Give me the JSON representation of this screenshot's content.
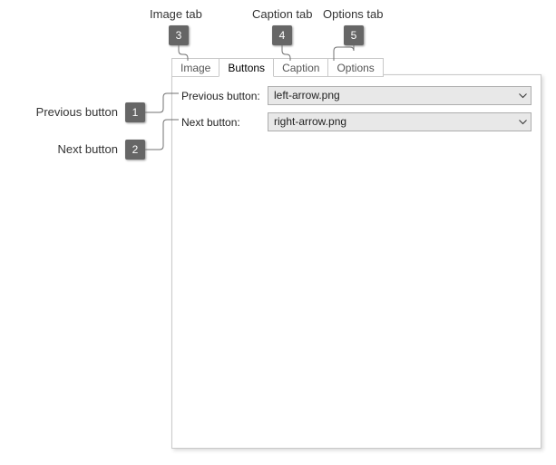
{
  "callouts": {
    "c1": {
      "num": "1",
      "text": "Previous button"
    },
    "c2": {
      "num": "2",
      "text": "Next button"
    },
    "c3": {
      "num": "3",
      "text": "Image tab"
    },
    "c4": {
      "num": "4",
      "text": "Caption tab"
    },
    "c5": {
      "num": "5",
      "text": "Options tab"
    }
  },
  "tabs": {
    "image": "Image",
    "buttons": "Buttons",
    "caption": "Caption",
    "options": "Options"
  },
  "form": {
    "prev_label": "Previous button:",
    "prev_value": "left-arrow.png",
    "next_label": "Next button:",
    "next_value": "right-arrow.png"
  }
}
